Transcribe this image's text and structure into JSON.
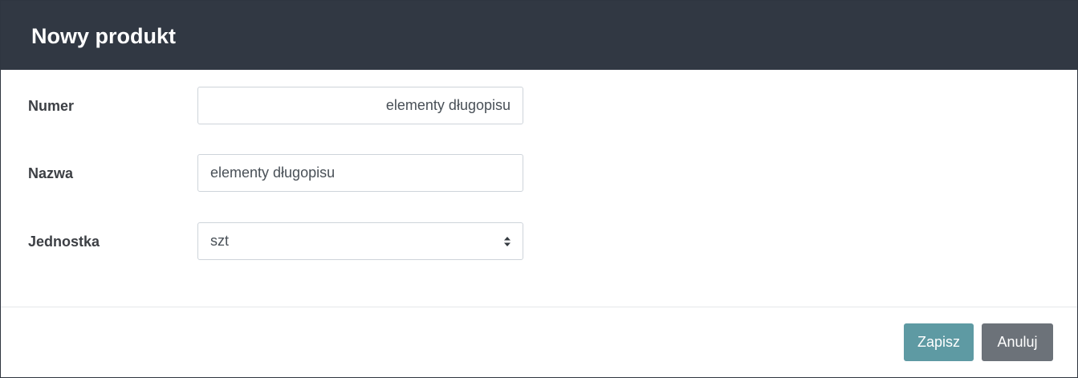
{
  "modal": {
    "title": "Nowy produkt"
  },
  "form": {
    "numer": {
      "label": "Numer",
      "value": "elementy długopisu"
    },
    "nazwa": {
      "label": "Nazwa",
      "value": "elementy długopisu"
    },
    "jednostka": {
      "label": "Jednostka",
      "selected": "szt",
      "icon": "sort-arrows-icon"
    }
  },
  "footer": {
    "save_label": "Zapisz",
    "cancel_label": "Anuluj"
  },
  "colors": {
    "header_bg": "#313843",
    "save_button": "#5e9aa3",
    "cancel_button": "#6c7279"
  }
}
